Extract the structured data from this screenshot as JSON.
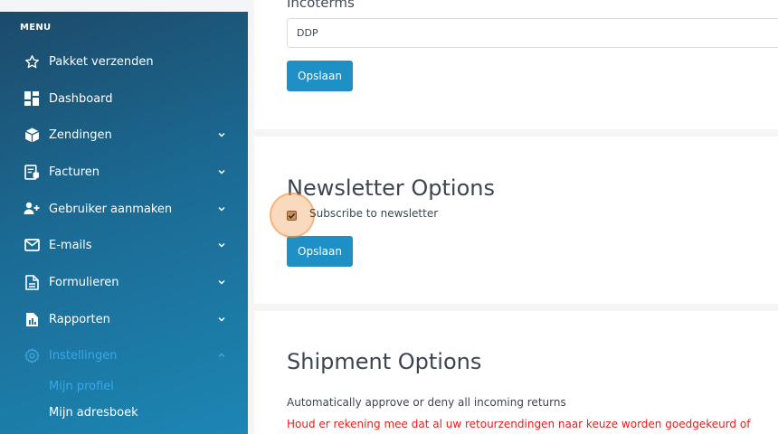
{
  "sidebar": {
    "menu_title": "MENU",
    "items": [
      {
        "label": "Pakket verzenden",
        "icon": "star-icon"
      },
      {
        "label": "Dashboard",
        "icon": "dashboard-icon"
      },
      {
        "label": "Zendingen",
        "icon": "box-icon",
        "expandable": true
      },
      {
        "label": "Facturen",
        "icon": "invoice-icon",
        "expandable": true
      },
      {
        "label": "Gebruiker aanmaken",
        "icon": "user-plus-icon",
        "expandable": true
      },
      {
        "label": "E-mails",
        "icon": "mail-icon",
        "expandable": true
      },
      {
        "label": "Formulieren",
        "icon": "document-icon",
        "expandable": true
      },
      {
        "label": "Rapporten",
        "icon": "report-icon",
        "expandable": true
      },
      {
        "label": "Instellingen",
        "icon": "gear-icon",
        "expandable": true,
        "active": true
      }
    ],
    "sub_items": [
      {
        "label": "Mijn profiel",
        "active": true
      },
      {
        "label": "Mijn adresboek"
      }
    ]
  },
  "incoterms": {
    "label": "Incoterms",
    "value": "DDP",
    "save_label": "Opslaan"
  },
  "newsletter": {
    "title": "Newsletter Options",
    "checkbox_label": "Subscribe to newsletter",
    "checked": true,
    "save_label": "Opslaan"
  },
  "shipment": {
    "title": "Shipment Options",
    "description": "Automatically approve or deny all incoming returns",
    "warning": "Houd er rekening mee dat al uw retourzendingen naar keuze worden goedgekeurd of"
  },
  "colors": {
    "accent": "#1f90c6",
    "active_nav": "#39a7e8",
    "warning": "#e0201f"
  }
}
